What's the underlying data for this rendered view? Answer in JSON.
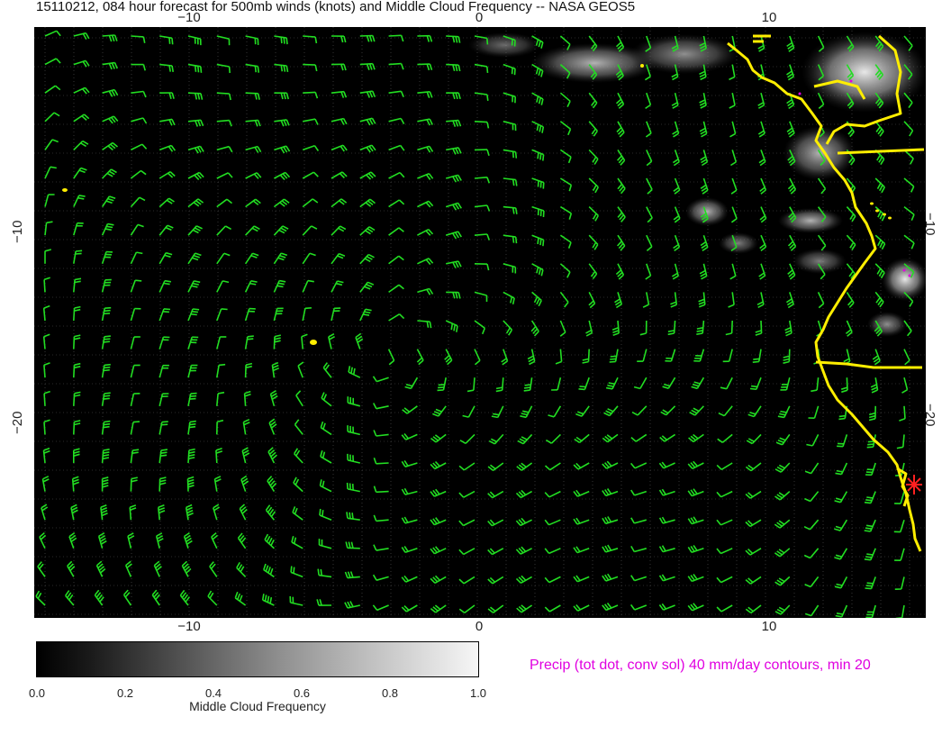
{
  "title": "15110212, 084 hour forecast for 500mb winds (knots) and Middle Cloud Frequency -- NASA GEOS5",
  "axes": {
    "x_ticks_top": [
      "−10",
      "0",
      "10"
    ],
    "x_ticks_bottom": [
      "−10",
      "0",
      "10"
    ],
    "y_ticks_left": [
      "−10",
      "−20"
    ],
    "y_ticks_right": [
      "−10",
      "−20"
    ]
  },
  "colorbar": {
    "ticks": [
      "0.0",
      "0.2",
      "0.4",
      "0.6",
      "0.8",
      "1.0"
    ],
    "label": "Middle Cloud Frequency"
  },
  "precip_label": "Precip (tot dot, conv sol) 40 mm/day contours, min 20",
  "colors": {
    "background": "#000000",
    "wind_barbs": "#22dd22",
    "coastline": "#ffee00",
    "precip": "#e000e0",
    "marker": "#ff2020",
    "grid": "#555555"
  },
  "icons": {
    "station_marker": "red-asterisk-icon"
  }
}
